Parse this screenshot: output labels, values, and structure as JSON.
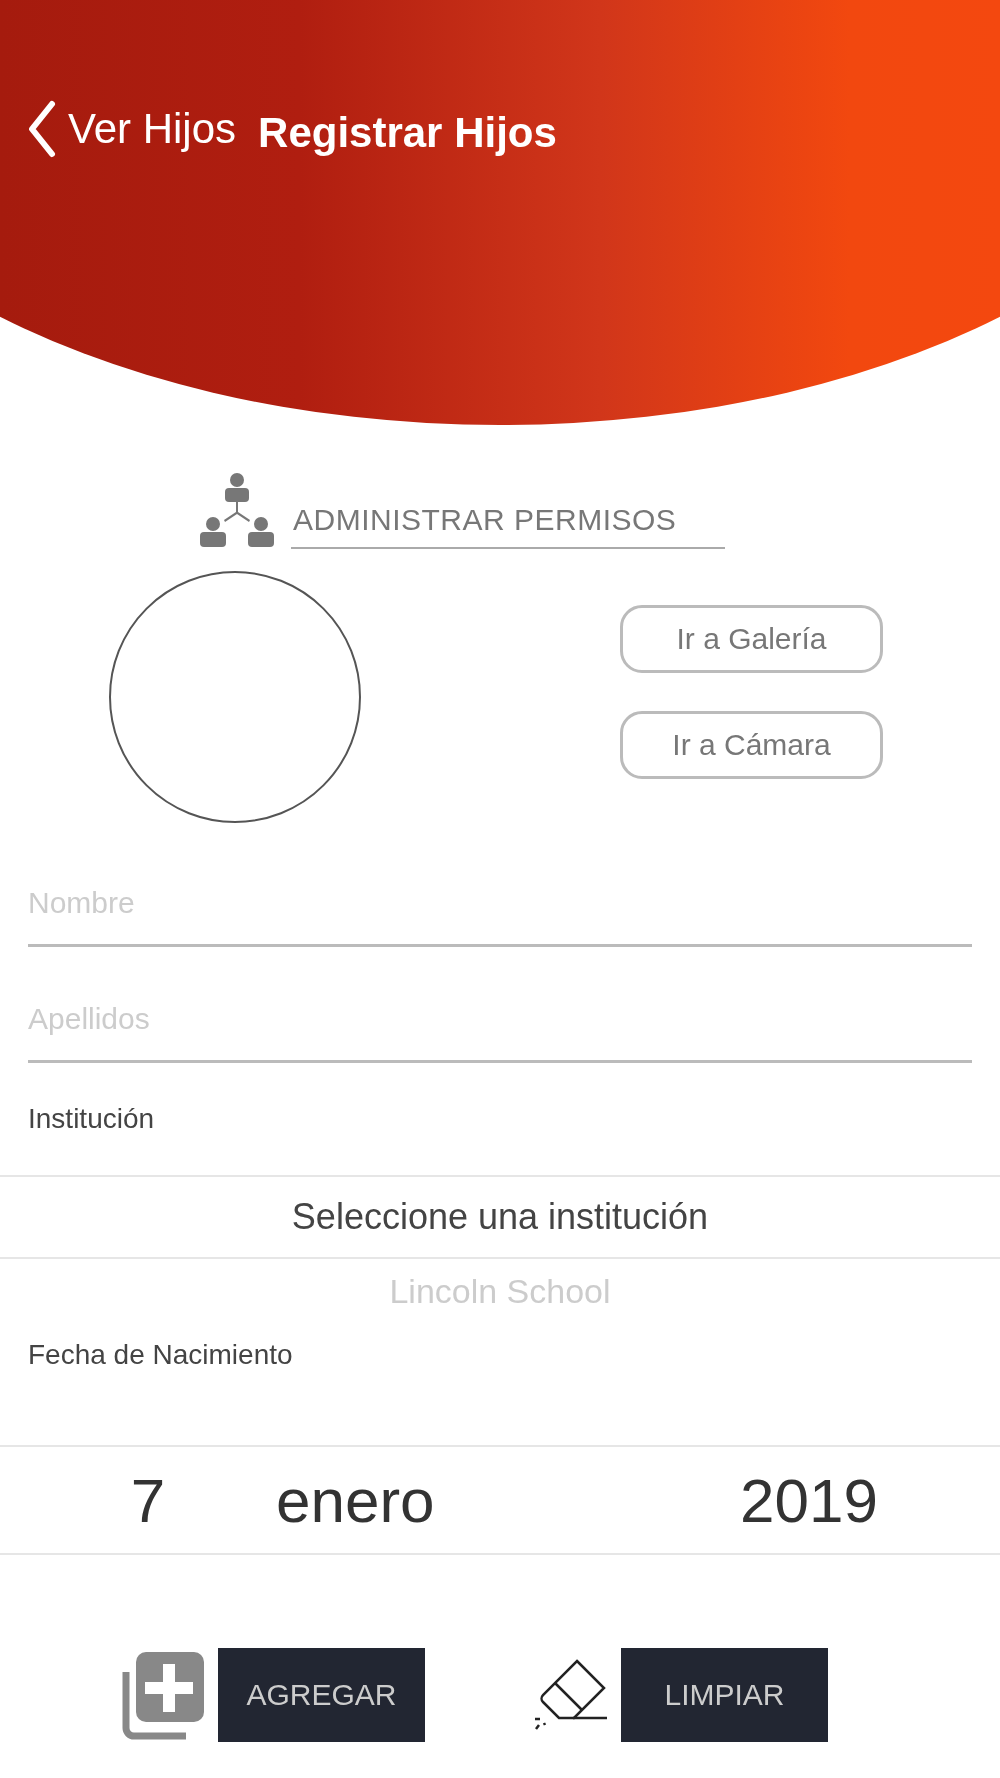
{
  "header": {
    "back_label": "Ver Hijos",
    "title": "Registrar Hijos"
  },
  "permissions_link": "ADMINISTRAR PERMISOS",
  "photo_buttons": [
    "Ir a Galería",
    "Ir a Cámara"
  ],
  "fields": [
    {
      "placeholder": "Nombre"
    },
    {
      "placeholder": "Apellidos"
    }
  ],
  "institution": {
    "label": "Institución",
    "options": [
      {
        "text": "Seleccione una institución",
        "selected": true
      },
      {
        "text": "Lincoln School",
        "selected": false
      }
    ]
  },
  "birth_date": {
    "label": "Fecha de Nacimiento",
    "day": "7",
    "month": "enero",
    "year": "2019"
  },
  "actions": [
    {
      "kind": "add",
      "label": "AGREGAR"
    },
    {
      "kind": "clear",
      "label": "LIMPIAR"
    }
  ]
}
